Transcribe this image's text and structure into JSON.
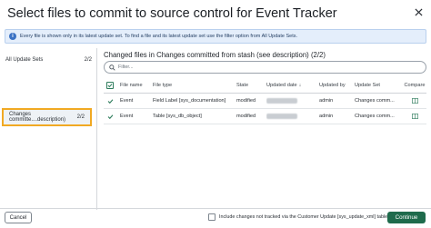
{
  "dialog": {
    "title": "Select files to commit to source control for Event Tracker",
    "close_icon": "close-icon"
  },
  "banner": {
    "icon": "info-icon",
    "text": "Every file is shown only in its latest update set. To find a file and its latest update set use the filter option from All Update Sets."
  },
  "update_sets": [
    {
      "label": "All Update Sets",
      "count": "2/2"
    },
    {
      "label": "Changes committe....description)",
      "count": "2/2",
      "selected": true,
      "highlight_color": "#f1a923"
    }
  ],
  "main": {
    "title": "Changed files in Changes committed from stash (see description) (2/2)",
    "filter_placeholder": "Filter...",
    "filter_icon": "search-icon"
  },
  "table": {
    "headers": {
      "file_name": "File name",
      "file_type": "File type",
      "state": "State",
      "updated_date": "Updated date",
      "sort_indicator": "↓",
      "updated_by": "Updated by",
      "update_set": "Update Set",
      "compare": "Compare"
    },
    "rows": [
      {
        "name": "Event",
        "type": "Field Label [sys_documentation]",
        "state": "modified",
        "updated_by": "admin",
        "update_set": "Changes comm...",
        "compare_icon": "compare-icon",
        "checked": true
      },
      {
        "name": "Event",
        "type": "Table [sys_db_object]",
        "state": "modified",
        "updated_by": "admin",
        "update_set": "Changes comm...",
        "compare_icon": "compare-icon",
        "checked": true
      }
    ]
  },
  "footer": {
    "cancel_label": "Cancel",
    "include_label": "Include changes not tracked via the Customer Update [sys_update_xml] table",
    "continue_label": "Continue"
  },
  "colors": {
    "accent": "#1f6b4c",
    "highlight": "#f1a923",
    "sorted_header": "#2e6bc4",
    "banner_bg": "#e4eefb"
  }
}
